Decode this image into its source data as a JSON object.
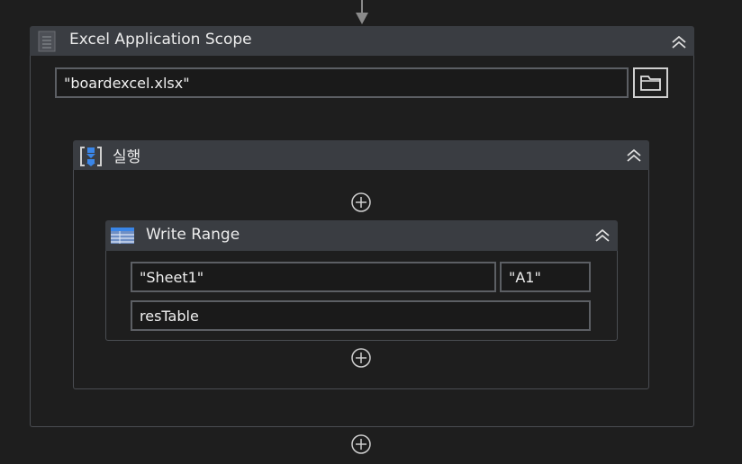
{
  "excel_scope": {
    "title": "Excel Application Scope",
    "workbook_path": "\"boardexcel.xlsx\""
  },
  "sequence": {
    "title": "실행"
  },
  "write_range": {
    "title": "Write Range",
    "sheet_name": "\"Sheet1\"",
    "start_cell": "\"A1\"",
    "data_table": "resTable"
  },
  "icons": {
    "scope": "excel-document-icon",
    "sequence": "sequence-icon",
    "write_range": "table-icon",
    "collapse": "double-chevron-up-icon",
    "folder": "folder-icon",
    "add": "plus-circle-icon"
  },
  "colors": {
    "background": "#1e1e1e",
    "header": "#3a3d42",
    "border": "#4a4d52",
    "accent_blue": "#3a86e8"
  }
}
